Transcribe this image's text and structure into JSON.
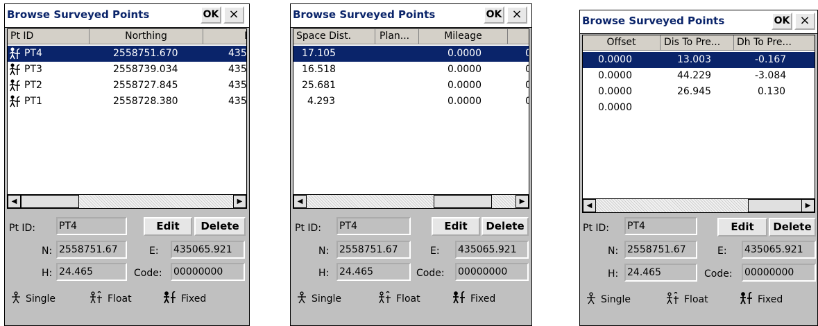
{
  "windows": [
    {
      "title": "Browse Surveyed Points",
      "ok_label": "OK",
      "close_label": "×",
      "columns": [
        "Pt ID",
        "Northing",
        "E"
      ],
      "rows": [
        {
          "cells": [
            "PT4",
            "2558751.670",
            "435"
          ],
          "icon": "fixed-point-icon"
        },
        {
          "cells": [
            "PT3",
            "2558739.034",
            "435"
          ],
          "icon": "fixed-point-icon"
        },
        {
          "cells": [
            "PT2",
            "2558727.845",
            "435"
          ],
          "icon": "fixed-point-icon"
        },
        {
          "cells": [
            "PT1",
            "2558728.380",
            "435"
          ],
          "icon": "fixed-point-icon"
        }
      ],
      "form": {
        "ptid_label": "Pt ID:",
        "ptid": "PT4",
        "edit_label": "Edit",
        "delete_label": "Delete",
        "n_label": "N:",
        "n": "2558751.67",
        "e_label": "E:",
        "e": "435065.921",
        "h_label": "H:",
        "h": "24.465",
        "code_label": "Code:",
        "code": "00000000"
      },
      "legend": {
        "single": "Single",
        "float": "Float",
        "fixed": "Fixed"
      }
    },
    {
      "title": "Browse Surveyed Points",
      "ok_label": "OK",
      "close_label": "×",
      "columns": [
        "Space Dist.",
        "Plan...",
        "Mileage",
        ""
      ],
      "rows": [
        {
          "cells": [
            "17.105",
            "",
            "0.0000",
            "0"
          ]
        },
        {
          "cells": [
            "16.518",
            "",
            "0.0000",
            "0"
          ]
        },
        {
          "cells": [
            "25.681",
            "",
            "0.0000",
            "0"
          ]
        },
        {
          "cells": [
            "4.293",
            "",
            "0.0000",
            "0"
          ]
        }
      ],
      "form": {
        "ptid_label": "Pt ID:",
        "ptid": "PT4",
        "edit_label": "Edit",
        "delete_label": "Delete",
        "n_label": "N:",
        "n": "2558751.67",
        "e_label": "E:",
        "e": "435065.921",
        "h_label": "H:",
        "h": "24.465",
        "code_label": "Code:",
        "code": "00000000"
      },
      "legend": {
        "single": "Single",
        "float": "Float",
        "fixed": "Fixed"
      }
    },
    {
      "title": "Browse Surveyed Points",
      "ok_label": "OK",
      "close_label": "×",
      "columns": [
        "Offset",
        "Dis To Pre...",
        "Dh To Pre..."
      ],
      "rows": [
        {
          "cells": [
            "0.0000",
            "13.003",
            "-0.167"
          ]
        },
        {
          "cells": [
            "0.0000",
            "44.229",
            "-3.084"
          ]
        },
        {
          "cells": [
            "0.0000",
            "26.945",
            "0.130"
          ]
        },
        {
          "cells": [
            "0.0000",
            "",
            ""
          ]
        }
      ],
      "form": {
        "ptid_label": "Pt ID:",
        "ptid": "PT4",
        "edit_label": "Edit",
        "delete_label": "Delete",
        "n_label": "N:",
        "n": "2558751.67",
        "e_label": "E:",
        "e": "435065.921",
        "h_label": "H:",
        "h": "24.465",
        "code_label": "Code:",
        "code": "00000000"
      },
      "legend": {
        "single": "Single",
        "float": "Float",
        "fixed": "Fixed"
      }
    }
  ],
  "colors": {
    "selection": "#0a246a",
    "dialog_bg": "#c0c0c0",
    "title_text": "#0a246a"
  }
}
